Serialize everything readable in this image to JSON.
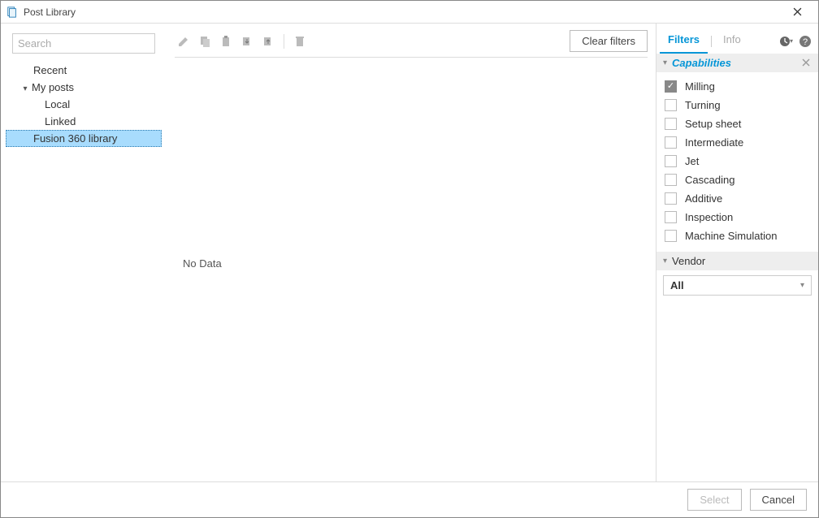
{
  "window": {
    "title": "Post Library"
  },
  "sidebar": {
    "search_placeholder": "Search",
    "items": [
      {
        "label": "Recent",
        "depth": 0
      },
      {
        "label": "My posts",
        "depth": 1,
        "expandable": true,
        "expanded": true
      },
      {
        "label": "Local",
        "depth": 2
      },
      {
        "label": "Linked",
        "depth": 2
      },
      {
        "label": "Fusion 360 library",
        "depth": 1,
        "selected": true
      }
    ]
  },
  "toolbar": {
    "clear_filters_label": "Clear filters"
  },
  "main": {
    "no_data_label": "No Data"
  },
  "right": {
    "tabs": {
      "filters": "Filters",
      "info": "Info",
      "active": "filters"
    },
    "capabilities_header": "Capabilities",
    "capabilities": [
      {
        "label": "Milling",
        "checked": true
      },
      {
        "label": "Turning",
        "checked": false
      },
      {
        "label": "Setup sheet",
        "checked": false
      },
      {
        "label": "Intermediate",
        "checked": false
      },
      {
        "label": "Jet",
        "checked": false
      },
      {
        "label": "Cascading",
        "checked": false
      },
      {
        "label": "Additive",
        "checked": false
      },
      {
        "label": "Inspection",
        "checked": false
      },
      {
        "label": "Machine Simulation",
        "checked": false
      }
    ],
    "vendor_header": "Vendor",
    "vendor_value": "All"
  },
  "footer": {
    "select_label": "Select",
    "cancel_label": "Cancel"
  }
}
